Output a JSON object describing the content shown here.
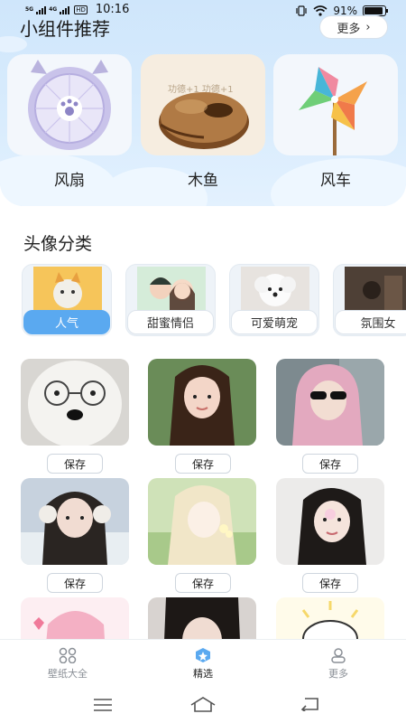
{
  "status_bar": {
    "signal_1": "5G",
    "signal_2": "4G",
    "hd": "HD",
    "time": "10:16",
    "battery": "91%",
    "battery_level": 0.91
  },
  "widgets": {
    "title": "小组件推荐",
    "more_label": "更多",
    "items": [
      {
        "label": "风扇",
        "icon": "fan-icon"
      },
      {
        "label": "木鱼",
        "icon": "wooden-fish-icon",
        "overlay_text": "功德+1 功德+1"
      },
      {
        "label": "风车",
        "icon": "pinwheel-icon"
      }
    ]
  },
  "avatar_section": {
    "title": "头像分类",
    "categories": [
      {
        "label": "人气",
        "active": true
      },
      {
        "label": "甜蜜情侣",
        "active": false
      },
      {
        "label": "可爱萌宠",
        "active": false
      },
      {
        "label": "氛围女",
        "active": false
      }
    ],
    "save_label": "保存"
  },
  "tabbar": {
    "items": [
      {
        "label": "壁纸大全",
        "icon": "grid-icon",
        "active": false
      },
      {
        "label": "精选",
        "icon": "star-badge-icon",
        "active": true
      },
      {
        "label": "更多",
        "icon": "person-icon",
        "active": false
      }
    ]
  },
  "colors": {
    "accent": "#5aa9f0",
    "hero_bg": "#d9ecfd"
  }
}
